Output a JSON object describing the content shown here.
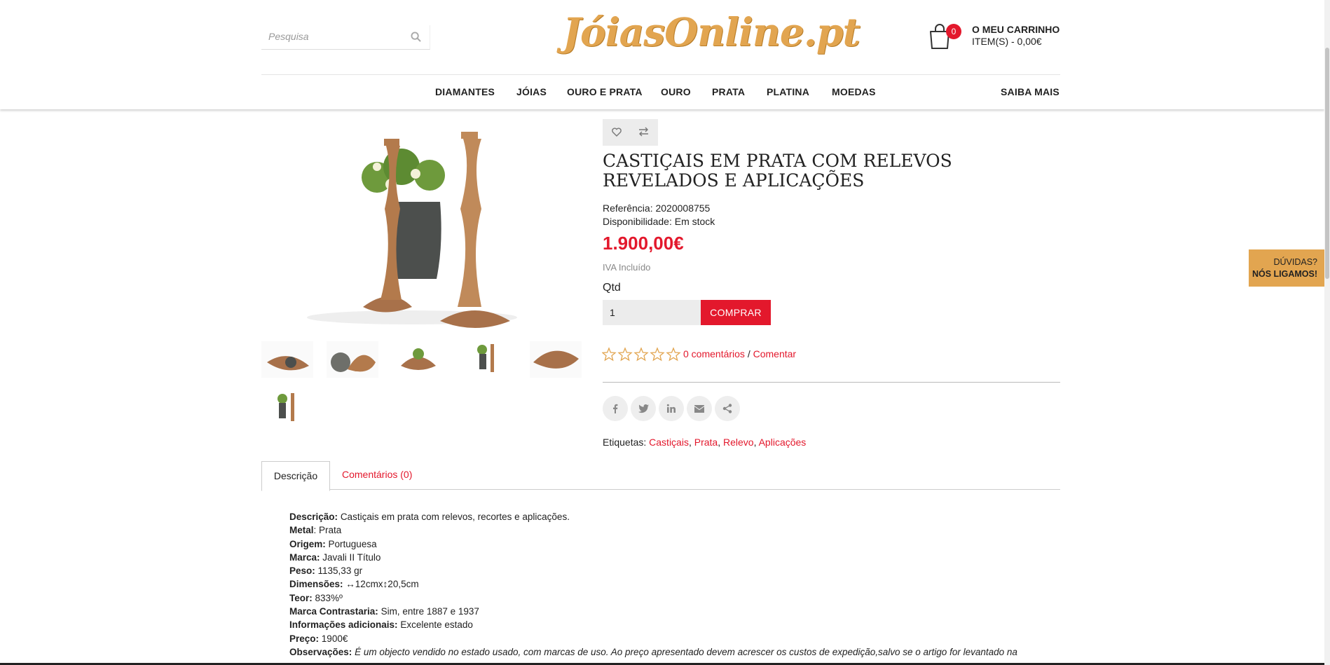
{
  "header": {
    "search_placeholder": "Pesquisa",
    "logo_text": "JóiasOnline.pt",
    "cart_count": "0",
    "cart_title": "O MEU CARRINHO",
    "cart_items": "ITEM(S) - 0,00€"
  },
  "nav": {
    "items": [
      "DIAMANTES",
      "JÓIAS",
      "OURO E PRATA",
      "OURO",
      "PRATA",
      "PLATINA",
      "MOEDAS"
    ],
    "right": "SAIBA MAIS"
  },
  "product": {
    "title": "CASTIÇAIS EM PRATA COM RELEVOS REVELADOS E APLICAÇÕES",
    "reference_label": "Referência:",
    "reference_value": "2020008755",
    "availability_label": "Disponibilidade:",
    "availability_value": "Em stock",
    "price": "1.900,00€",
    "vat": "IVA Incluído",
    "qty_label": "Qtd",
    "qty_value": "1",
    "buy_label": "COMPRAR",
    "reviews_link": "0 comentários",
    "reviews_sep": "/",
    "comment_link": "Comentar",
    "tags_label": "Etiquetas:",
    "tags": [
      "Castiçais",
      "Prata",
      "Relevo",
      "Aplicações"
    ]
  },
  "tabs": {
    "description": "Descrição",
    "comments": "Comentários (0)"
  },
  "description": [
    {
      "label": "Descrição:",
      "value": "Castiçais em prata com relevos, recortes e aplicações."
    },
    {
      "label": "Metal",
      "value": ": Prata"
    },
    {
      "label": "Origem:",
      "value": "Portuguesa"
    },
    {
      "label": "Marca:",
      "value": "Javali II Título"
    },
    {
      "label": "Peso:",
      "value": "1135,33 gr"
    },
    {
      "label": "Dimensões:",
      "value": "↔12cmx↕20,5cm"
    },
    {
      "label": "Teor:",
      "value": "833%º"
    },
    {
      "label": "Marca Contrastaria:",
      "value": "Sim, entre 1887 e 1937"
    },
    {
      "label": "Informações adicionais:",
      "value": "Excelente estado"
    },
    {
      "label": "Preço:",
      "value": "1900€"
    },
    {
      "label": "Observações:",
      "value": "É um objecto vendido no estado usado, com marcas de uso. Ao preço apresentado devem acrescer os custos de expedição,salvo se o artigo for levantado na"
    }
  ],
  "callback": {
    "line1": "DÚVIDAS?",
    "line2": "NÓS LIGAMOS!"
  },
  "colors": {
    "accent": "#e3182c",
    "logo": "#e2a550",
    "bronze": "#b37a4c"
  }
}
